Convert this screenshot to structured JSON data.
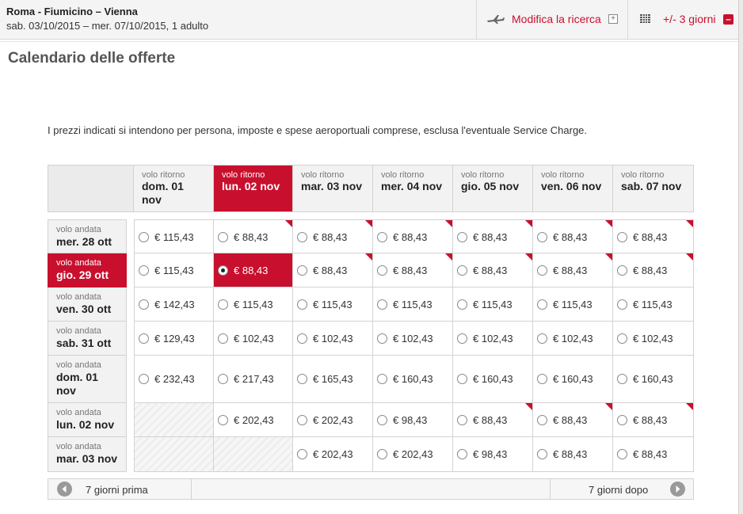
{
  "header": {
    "route": "Roma - Fiumicino – Vienna",
    "dates": "sab. 03/10/2015 – mer. 07/10/2015, 1 adulto",
    "modify_label": "Modifica la ricerca",
    "days_label": "+/- 3 giorni",
    "plus_glyph": "+",
    "minus_glyph": "–"
  },
  "page": {
    "title": "Calendario delle offerte",
    "notice": "I prezzi indicati si intendono per persona, imposte e spese aeroportuali comprese, esclusa l'eventuale Service Charge."
  },
  "calendar": {
    "return_caption": "volo ritorno",
    "outbound_caption": "volo andata",
    "accent_color": "#c8102e",
    "columns": [
      {
        "day": "dom. 01 nov"
      },
      {
        "day": "lun. 02 nov"
      },
      {
        "day": "mar. 03 nov"
      },
      {
        "day": "mer. 04 nov"
      },
      {
        "day": "gio. 05 nov"
      },
      {
        "day": "ven. 06 nov"
      },
      {
        "day": "sab. 07 nov"
      }
    ],
    "rows": [
      {
        "day": "mer. 28 ott",
        "prices": [
          "€ 115,43",
          "€ 88,43",
          "€ 88,43",
          "€ 88,43",
          "€ 88,43",
          "€ 88,43",
          "€ 88,43"
        ]
      },
      {
        "day": "gio. 29 ott",
        "prices": [
          "€ 115,43",
          "€ 88,43",
          "€ 88,43",
          "€ 88,43",
          "€ 88,43",
          "€ 88,43",
          "€ 88,43"
        ]
      },
      {
        "day": "ven. 30 ott",
        "prices": [
          "€ 142,43",
          "€ 115,43",
          "€ 115,43",
          "€ 115,43",
          "€ 115,43",
          "€ 115,43",
          "€ 115,43"
        ]
      },
      {
        "day": "sab. 31 ott",
        "prices": [
          "€ 129,43",
          "€ 102,43",
          "€ 102,43",
          "€ 102,43",
          "€ 102,43",
          "€ 102,43",
          "€ 102,43"
        ]
      },
      {
        "day": "dom. 01 nov",
        "prices": [
          "€ 232,43",
          "€ 217,43",
          "€ 165,43",
          "€ 160,43",
          "€ 160,43",
          "€ 160,43",
          "€ 160,43"
        ]
      },
      {
        "day": "lun. 02 nov",
        "prices": [
          null,
          "€ 202,43",
          "€ 202,43",
          "€ 98,43",
          "€ 88,43",
          "€ 88,43",
          "€ 88,43"
        ]
      },
      {
        "day": "mar. 03 nov",
        "prices": [
          null,
          null,
          "€ 202,43",
          "€ 202,43",
          "€ 98,43",
          "€ 88,43",
          "€ 88,43"
        ]
      }
    ],
    "selected_row": 1,
    "selected_col": 1
  },
  "nav": {
    "prev_label": "7 giorni prima",
    "next_label": "7 giorni dopo"
  }
}
